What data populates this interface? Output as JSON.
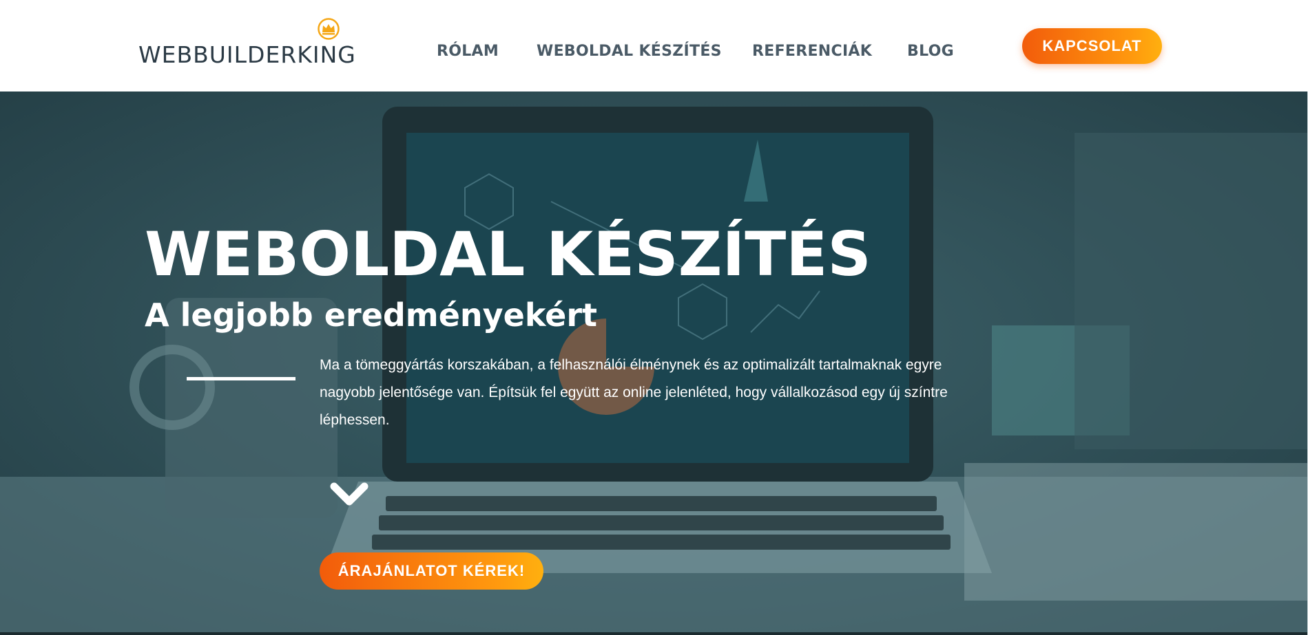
{
  "header": {
    "logo_text": "WEBBUILDERKING",
    "nav": [
      {
        "label": "RÓLAM"
      },
      {
        "label": "WEBOLDAL KÉSZÍTÉS"
      },
      {
        "label": "REFERENCIÁK"
      },
      {
        "label": "BLOG"
      }
    ],
    "contact_label": "KAPCSOLAT"
  },
  "hero": {
    "title": "WEBOLDAL KÉSZÍTÉS",
    "subtitle": "A legjobb eredményekért",
    "description": "Ma a tömeggyártás korszakában, a felhasználói élménynek és az optimalizált tartalmaknak egyre nagyobb jelentősége van. Építsük fel együtt  az online jelenléted, hogy vállalkozásod egy új színtre léphessen.",
    "cta_label": "ÁRAJÁNLATOT KÉREK!",
    "scroll_icon": "chevron-down-icon",
    "background_icon": "laptop-photo"
  },
  "colors": {
    "accent_start": "#f25c0b",
    "accent_end": "#ffb00f",
    "hero_overlay": "#2e4f57",
    "nav_text": "#4a5a66",
    "crown": "#f5a716"
  }
}
